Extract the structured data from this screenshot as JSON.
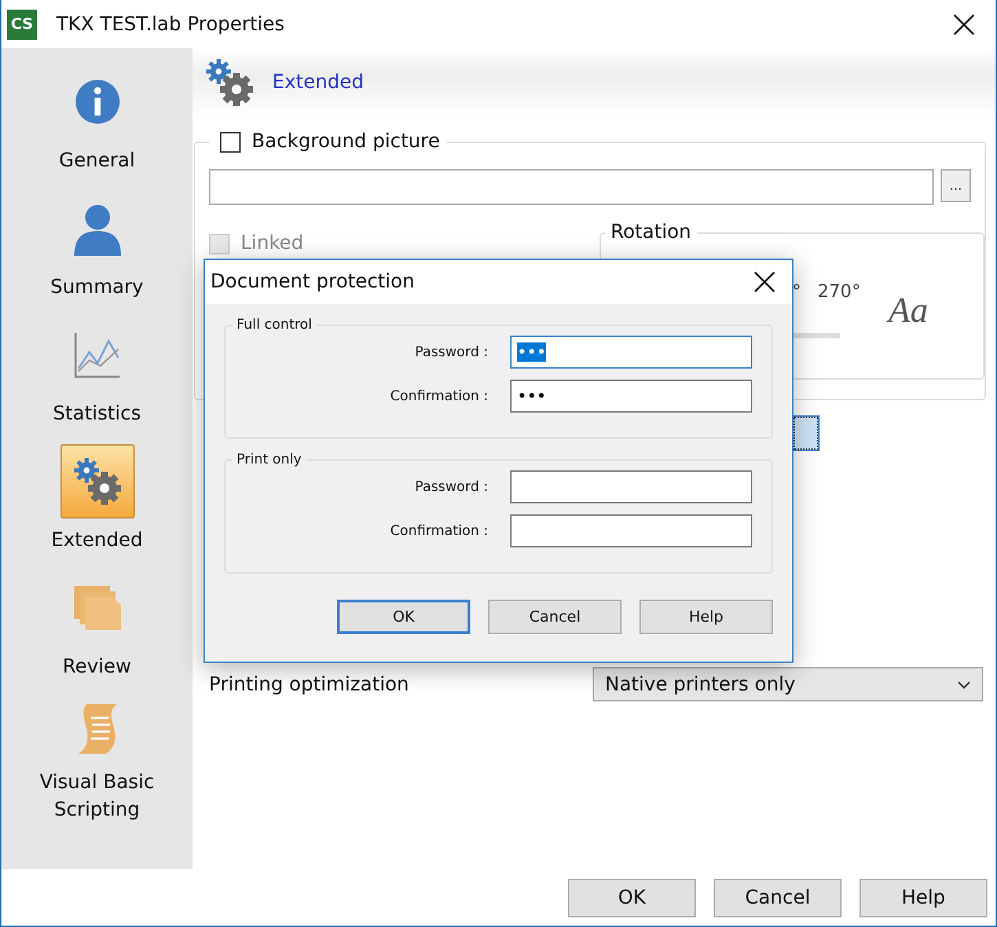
{
  "window": {
    "logo": "CS",
    "title": "TKX TEST.lab Properties"
  },
  "sidebar": {
    "items": [
      {
        "label": "General",
        "selected": false
      },
      {
        "label": "Summary",
        "selected": false
      },
      {
        "label": "Statistics",
        "selected": false
      },
      {
        "label": "Extended",
        "selected": true
      },
      {
        "label": "Review",
        "selected": false
      },
      {
        "label": "Visual Basic Scripting",
        "selected": false
      }
    ]
  },
  "header": {
    "title": "Extended"
  },
  "background_picture": {
    "label": "Background picture",
    "checked": false,
    "browse": "..."
  },
  "linked": {
    "label": "Linked",
    "checked": false,
    "disabled": true
  },
  "rotation": {
    "title": "Rotation",
    "options": [
      "°",
      "270°"
    ],
    "sample": "Aa"
  },
  "printing_optimization": {
    "label": "Printing optimization",
    "value": "Native printers only"
  },
  "buttons": [
    {
      "label": "OK"
    },
    {
      "label": "Cancel"
    },
    {
      "label": "Help"
    }
  ],
  "dialog": {
    "title": "Document protection",
    "groups": [
      {
        "title": "Full control",
        "fields": [
          {
            "label": "Password :",
            "value": "•••",
            "focused": true
          },
          {
            "label": "Confirmation :",
            "value": "•••",
            "focused": false
          }
        ]
      },
      {
        "title": "Print only",
        "fields": [
          {
            "label": "Password :",
            "focused": false
          },
          {
            "label": "Confirmation :",
            "focused": false
          }
        ]
      }
    ],
    "buttons": [
      {
        "label": "OK",
        "default": true
      },
      {
        "label": "Cancel",
        "default": false
      },
      {
        "label": "Help",
        "default": false
      }
    ]
  }
}
